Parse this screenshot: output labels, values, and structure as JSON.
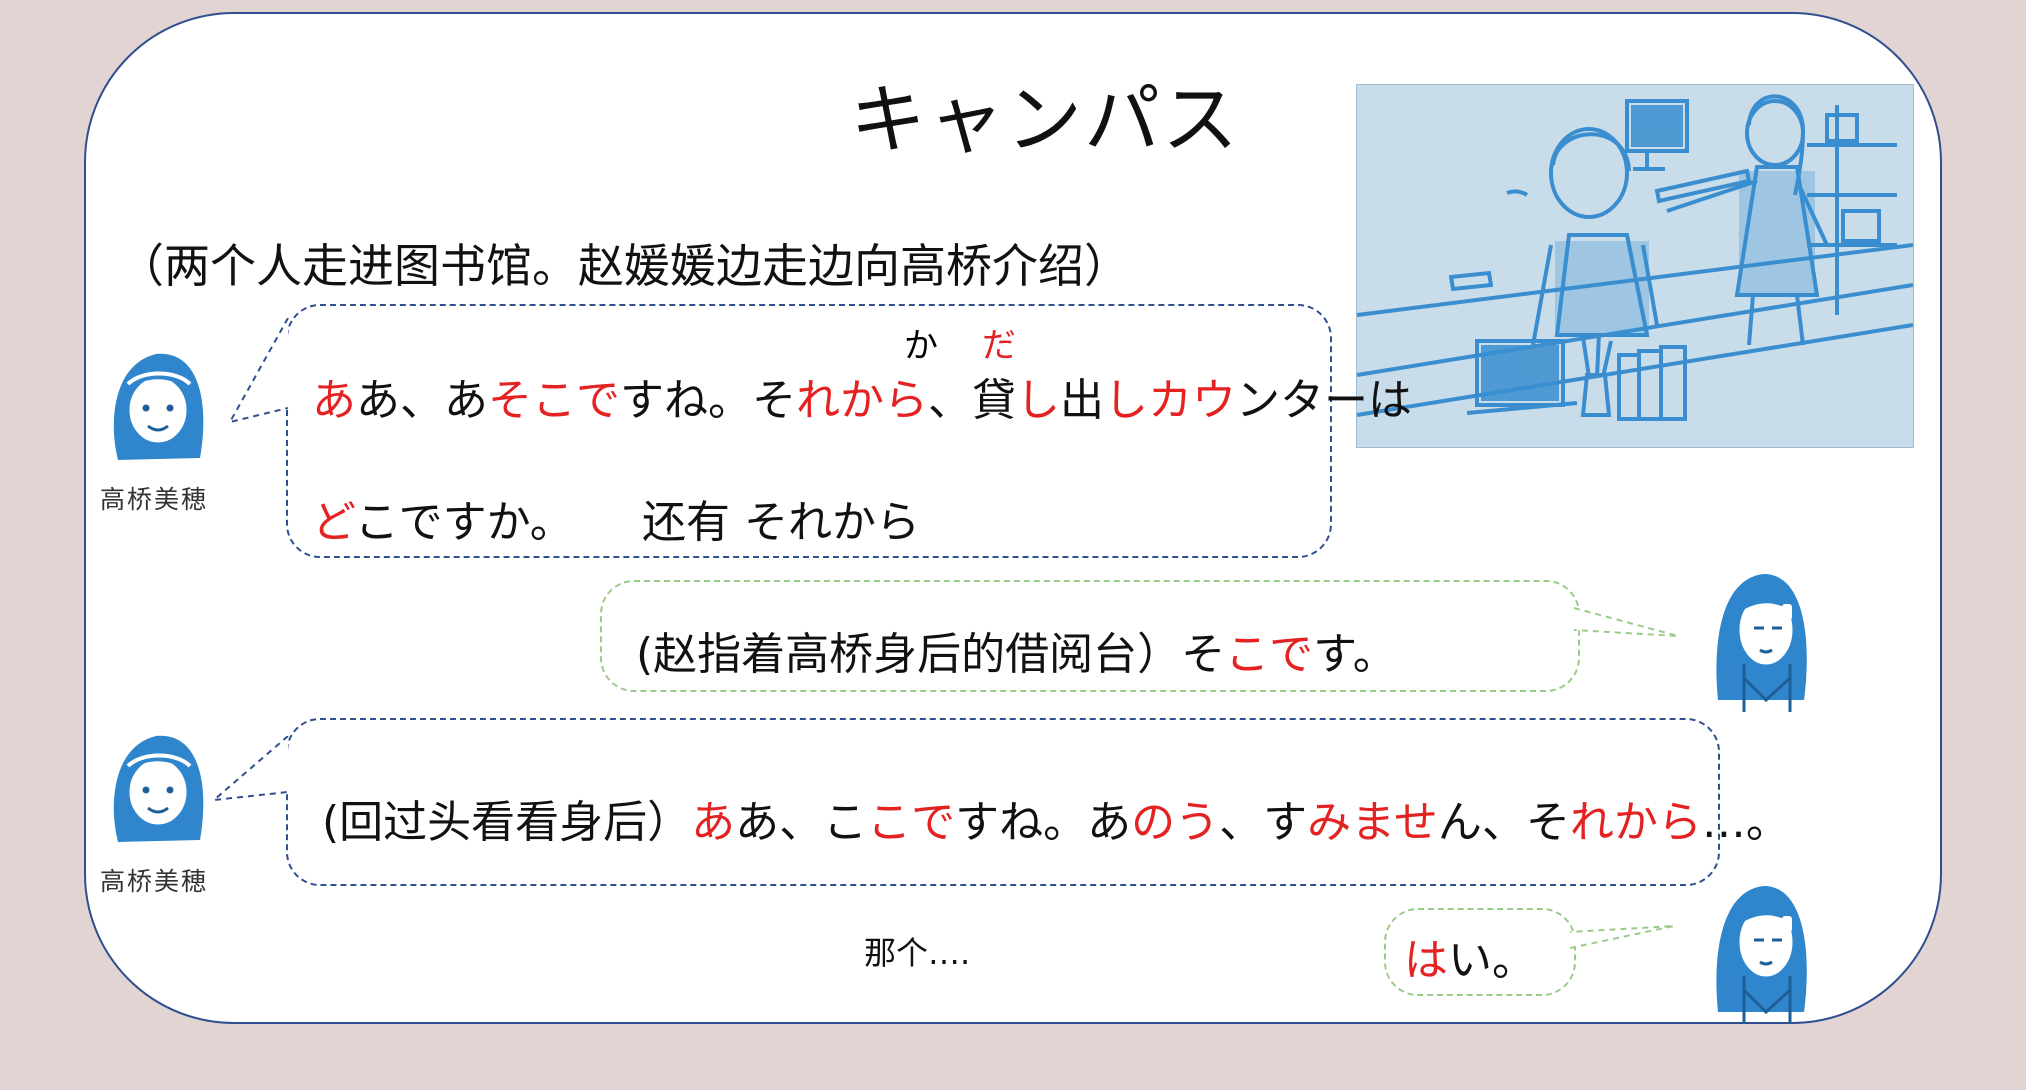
{
  "title": "キャンパス",
  "situation": "（两个人走进图书馆。赵媛媛边走边向高桥介绍）",
  "colors": {
    "accent": "#e52222",
    "frame": "#2f4f8f",
    "green_dash": "#9acb8a",
    "illustration": "#3a8ed0"
  },
  "speaker_caption": "高桥美穂",
  "line1": {
    "furigana_ka": "か",
    "furigana_da": "だ",
    "row1": [
      "あ",
      "あ、あ",
      "そこで",
      "すね。そ",
      "れから",
      "、",
      "貸",
      "し",
      "出",
      "しカウ",
      "ンターは"
    ],
    "row2": [
      "ど",
      "こですか。"
    ],
    "note": "还有 それから"
  },
  "line2": {
    "parts": [
      "(赵指着高桥身后的借阅台）",
      "そ",
      "こで",
      "す。"
    ]
  },
  "line3": {
    "parts": [
      "(回过头看看身后）",
      "あ",
      "あ、こ",
      "こで",
      "すね。あ",
      "のう",
      "、す",
      "みませ",
      "ん、そ",
      "れから",
      "…。"
    ]
  },
  "note_under": "那个….",
  "line4": {
    "parts": [
      "は",
      "い。"
    ]
  }
}
